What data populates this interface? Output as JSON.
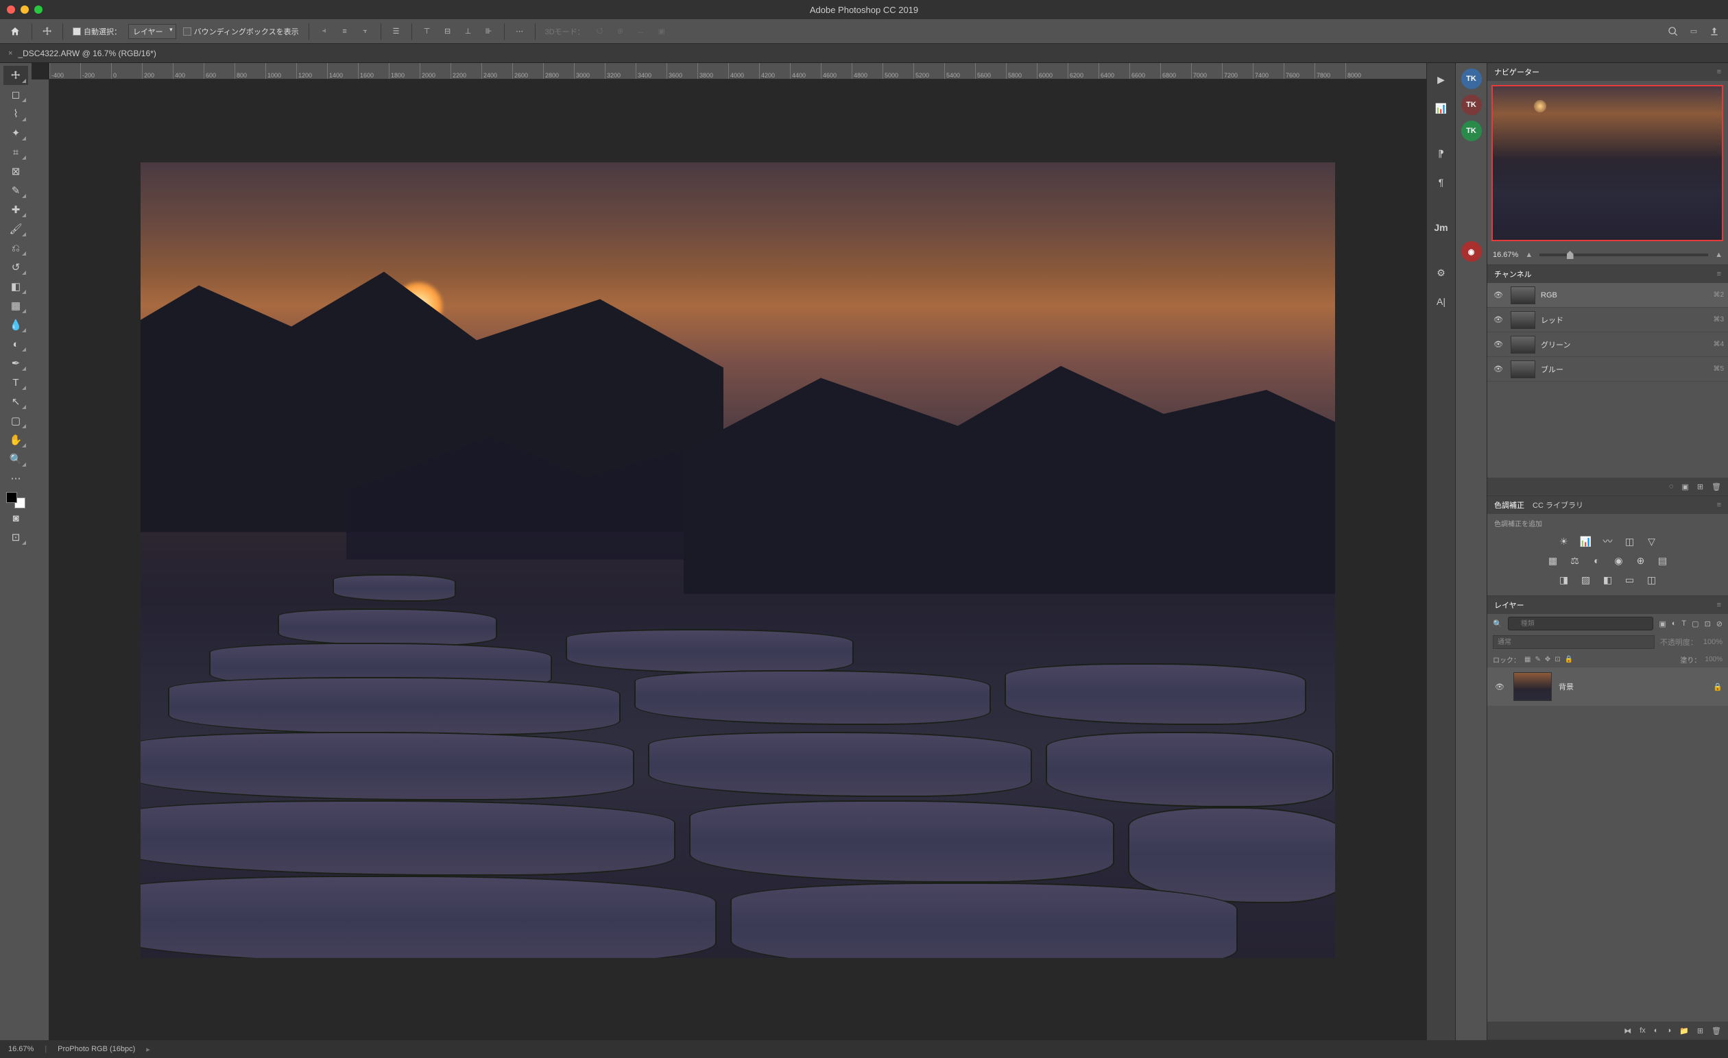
{
  "app": {
    "title": "Adobe Photoshop CC 2019"
  },
  "options": {
    "auto_select_label": "自動選択：",
    "layer_dd": "レイヤー",
    "bbox_label": "バウンディングボックスを表示",
    "mode3d": "3Dモード："
  },
  "document": {
    "tab": "_DSC4322.ARW @ 16.7% (RGB/16*)",
    "zoom": "16.67%",
    "profile": "ProPhoto RGB (16bpc)"
  },
  "ruler": [
    "-400",
    "-200",
    "0",
    "200",
    "400",
    "600",
    "800",
    "1000",
    "1200",
    "1400",
    "1600",
    "1800",
    "2000",
    "2200",
    "2400",
    "2600",
    "2800",
    "3000",
    "3200",
    "3400",
    "3600",
    "3800",
    "4000",
    "4200",
    "4400",
    "4600",
    "4800",
    "5000",
    "5200",
    "5400",
    "5600",
    "5800",
    "6000",
    "6200",
    "6400",
    "6600",
    "6800",
    "7000",
    "7200",
    "7400",
    "7600",
    "7800",
    "8000"
  ],
  "navigator": {
    "title": "ナビゲーター",
    "zoom": "16.67%"
  },
  "channels": {
    "title": "チャンネル",
    "items": [
      {
        "name": "RGB",
        "key": "⌘2"
      },
      {
        "name": "レッド",
        "key": "⌘3"
      },
      {
        "name": "グリーン",
        "key": "⌘4"
      },
      {
        "name": "ブルー",
        "key": "⌘5"
      }
    ]
  },
  "adjustments": {
    "tab1": "色調補正",
    "tab2": "CC ライブラリ",
    "label": "色調補正を追加"
  },
  "layers": {
    "title": "レイヤー",
    "search_placeholder": "種類",
    "blend": "通常",
    "opacity_label": "不透明度：",
    "opacity": "100%",
    "lock_label": "ロック：",
    "fill_label": "塗り：",
    "fill": "100%",
    "bg_name": "背景"
  }
}
